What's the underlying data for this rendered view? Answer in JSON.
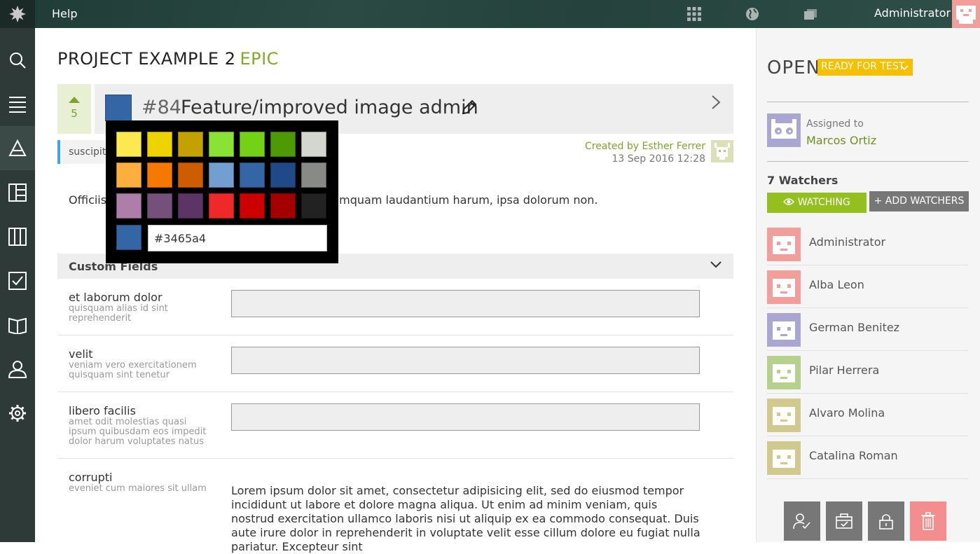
{
  "topbar": {
    "help_label": "Help",
    "user_name": "Administrator",
    "icons": [
      "projects-grid-icon",
      "globe-icon",
      "folders-icon"
    ]
  },
  "sidenav": {
    "items": [
      "search-icon",
      "backlog-icon",
      "epics-icon",
      "kanban-icon",
      "board-icon",
      "issues-icon",
      "wiki-icon",
      "team-icon",
      "settings-icon"
    ]
  },
  "project": {
    "name": "PROJECT EXAMPLE 2",
    "type": "EPIC"
  },
  "epic": {
    "votes": "5",
    "ref": "#84",
    "subject": "Feature/improved image admin",
    "color": "#3465a4",
    "tag": "suscipit",
    "created_by": "Created by Esther Ferrer",
    "created_date": "13 Sep 2016 12:28",
    "description_start": "Officiis",
    "description_end": "umquam laudantium harum, ipsa dolorum non."
  },
  "color_picker": {
    "swatches": [
      "#fce94f",
      "#edd400",
      "#c4a000",
      "#8ae234",
      "#73d216",
      "#4e9a06",
      "#d3d7cf",
      "#fcaf3e",
      "#f57900",
      "#ce5c00",
      "#729fcf",
      "#3465a4",
      "#204a87",
      "#888a85",
      "#ad7fa8",
      "#75507b",
      "#5c3566",
      "#ef2929",
      "#cc0000",
      "#a40000",
      "#222222"
    ],
    "selected_color": "#3465a4",
    "hex_value": "#3465a4"
  },
  "custom_fields": {
    "title": "Custom Fields",
    "fields": [
      {
        "label": "et laborum dolor",
        "description": "quisquam alias id sint reprehenderit",
        "value": ""
      },
      {
        "label": "velit",
        "description": "veniam vero exercitationem quisquam sint tenetur",
        "value": ""
      },
      {
        "label": "libero facilis",
        "description": "amet odit molestias quasi ipsum quibusdam eos impedit dolor harum voluptates natus",
        "value": ""
      },
      {
        "label": "corrupti",
        "description": "eveniet cum maiores sit ullam",
        "value": "Lorem ipsum dolor sit amet, consectetur adipisicing elit, sed do eiusmod tempor incididunt ut labore et dolore magna aliqua. Ut enim ad minim veniam, quis nostrud exercitation ullamco laboris nisi ut aliquip ex ea commodo consequat. Duis aute irure dolor in reprehenderit in voluptate velit esse cillum dolore eu fugiat nulla pariatur. Excepteur sint"
      }
    ]
  },
  "sidebar": {
    "status": "OPEN",
    "status_badge": "READY FOR TEST",
    "assigned_label": "Assigned to",
    "assigned_name": "Marcos Ortiz",
    "watchers_title": "7 Watchers",
    "watching_label": "WATCHING",
    "add_watchers_label": "+ ADD WATCHERS",
    "watchers": [
      {
        "name": "Administrator",
        "color": "#f29e9b"
      },
      {
        "name": "Alba Leon",
        "color": "#f29e9b"
      },
      {
        "name": "German Benitez",
        "color": "#a9a6d2"
      },
      {
        "name": "Pilar Herrera",
        "color": "#b6d18e"
      },
      {
        "name": "Alvaro Molina",
        "color": "#d2c98e"
      },
      {
        "name": "Catalina Roman",
        "color": "#d2c98e"
      }
    ],
    "actions": [
      "assign-to-me-icon",
      "move-icon",
      "lock-icon",
      "trash-icon"
    ]
  }
}
